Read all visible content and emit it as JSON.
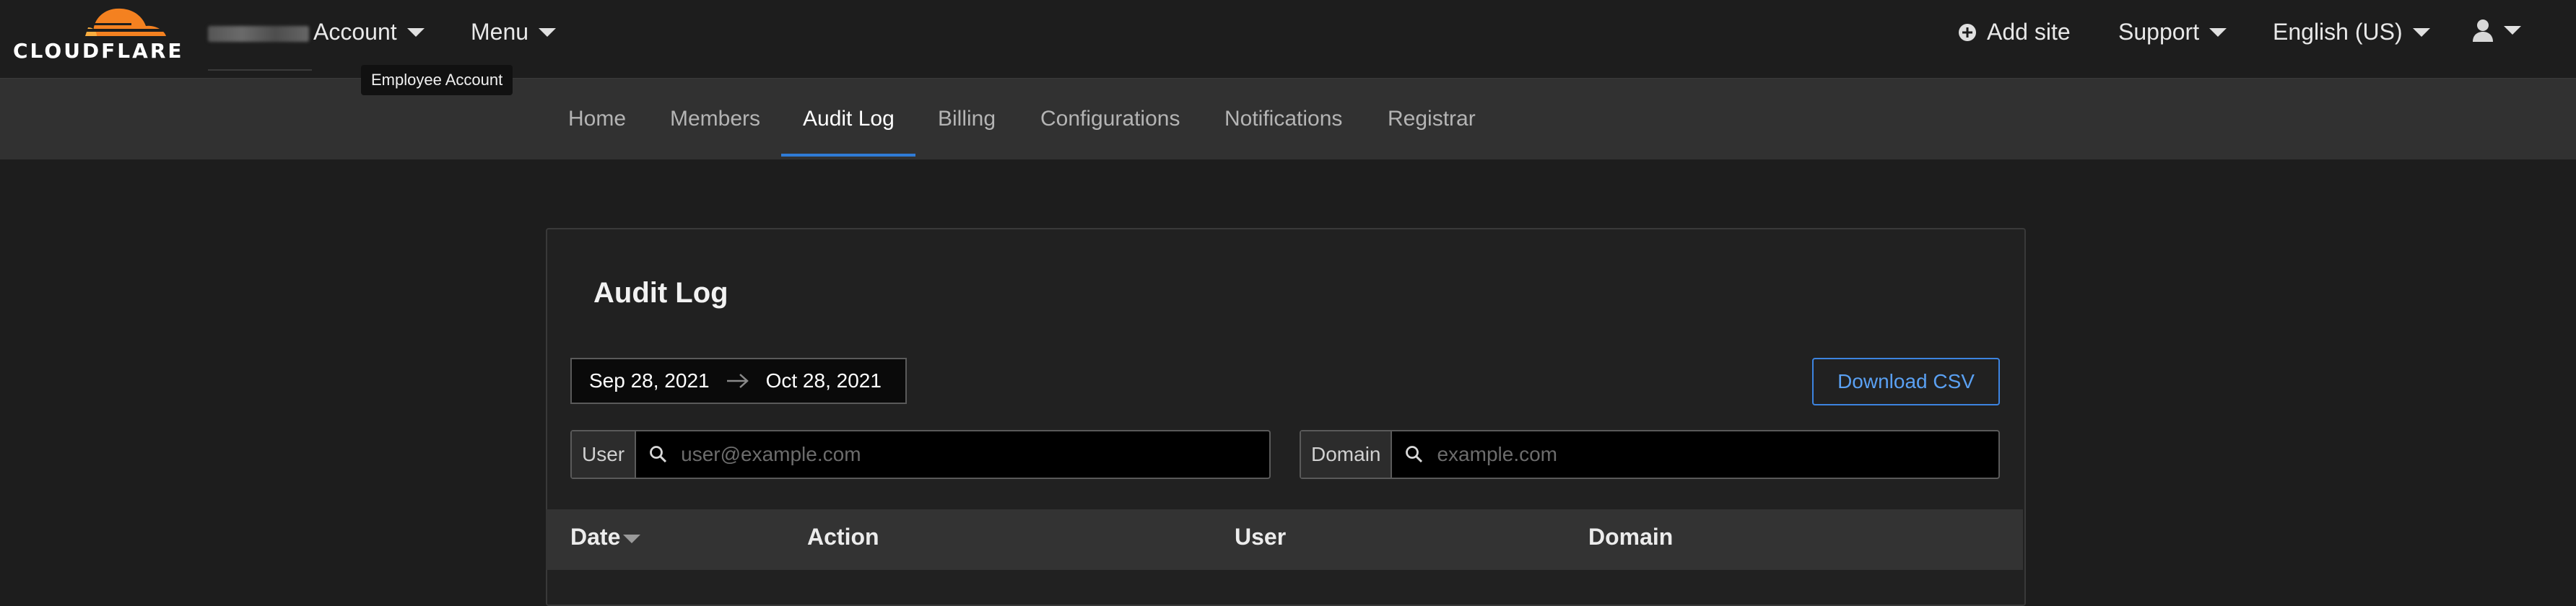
{
  "brand": {
    "name": "CLOUDFLARE",
    "accent": "#f48120",
    "accent_light": "#faad3f"
  },
  "header": {
    "account_label": "Account",
    "menu_label": "Menu",
    "tooltip": "Employee Account",
    "add_site_label": "Add site",
    "support_label": "Support",
    "language_label": "English (US)"
  },
  "subnav": {
    "tabs": [
      {
        "label": "Home"
      },
      {
        "label": "Members"
      },
      {
        "label": "Audit Log",
        "active": true
      },
      {
        "label": "Billing"
      },
      {
        "label": "Configurations"
      },
      {
        "label": "Notifications"
      },
      {
        "label": "Registrar"
      }
    ],
    "active_color": "#2f7bd6"
  },
  "audit": {
    "title": "Audit Log",
    "date_from": "Sep 28, 2021",
    "date_to": "Oct 28, 2021",
    "download_label": "Download CSV",
    "filters": {
      "user_label": "User",
      "user_placeholder": "user@example.com",
      "domain_label": "Domain",
      "domain_placeholder": "example.com"
    },
    "columns": [
      "Date",
      "Action",
      "User",
      "Domain"
    ]
  }
}
